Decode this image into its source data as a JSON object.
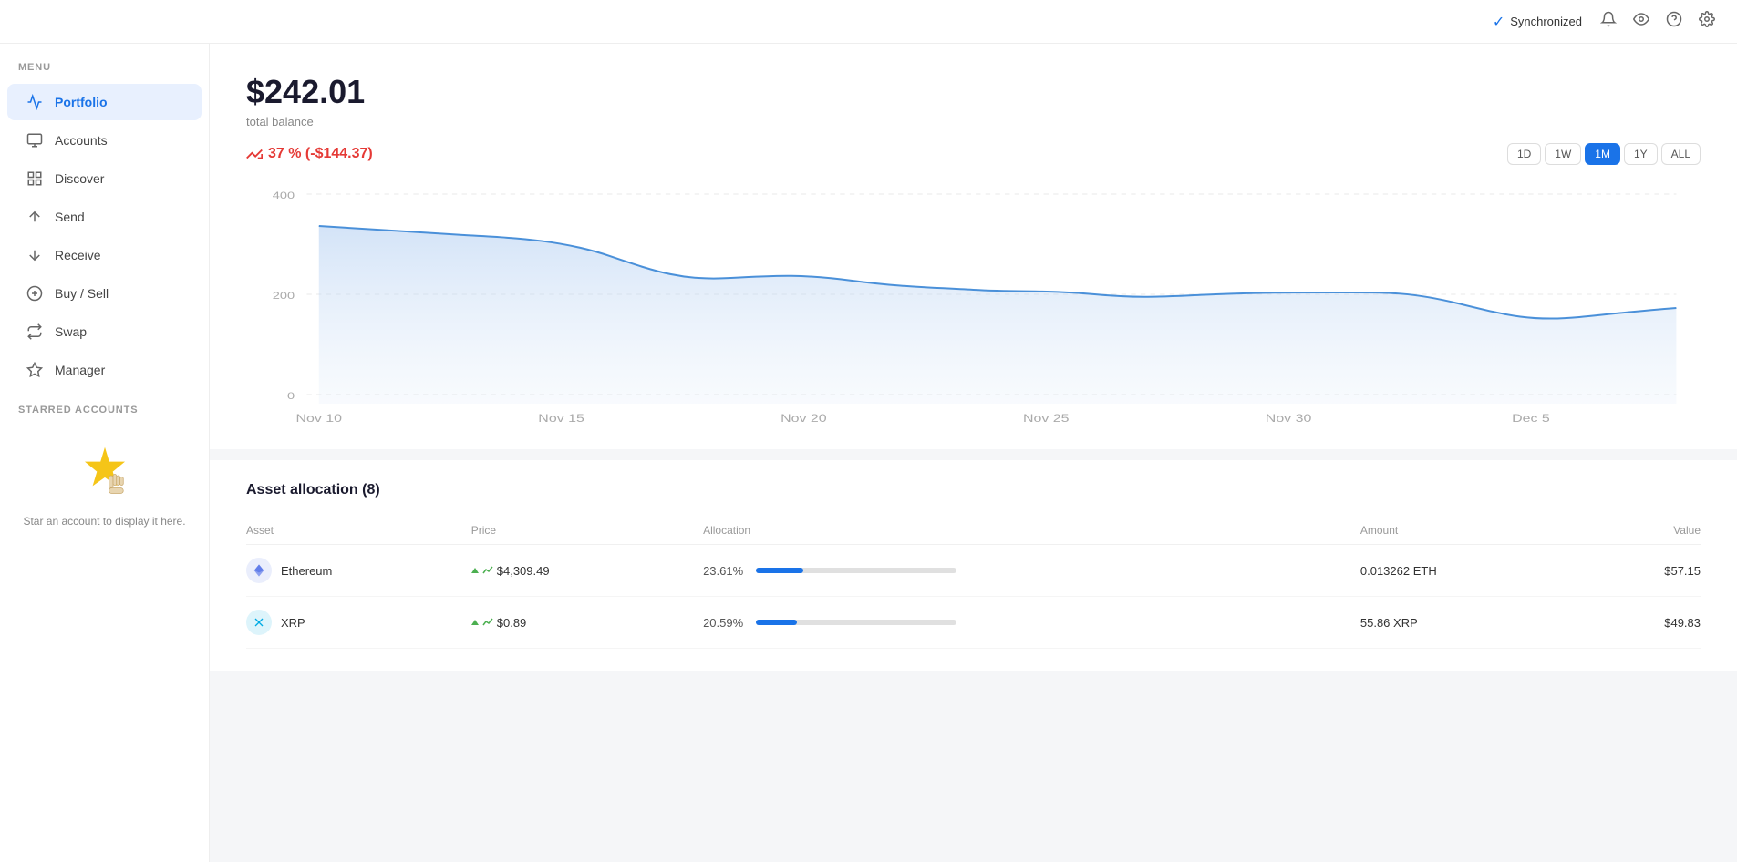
{
  "topbar": {
    "sync_label": "Synchronized",
    "bell_icon": "🔔",
    "eye_icon": "👁",
    "help_icon": "?",
    "settings_icon": "⚙"
  },
  "sidebar": {
    "menu_label": "MENU",
    "items": [
      {
        "id": "portfolio",
        "label": "Portfolio",
        "icon": "📈",
        "active": true
      },
      {
        "id": "accounts",
        "label": "Accounts",
        "icon": "🗂"
      },
      {
        "id": "discover",
        "label": "Discover",
        "icon": "⊞"
      },
      {
        "id": "send",
        "label": "Send",
        "icon": "↑"
      },
      {
        "id": "receive",
        "label": "Receive",
        "icon": "↓"
      },
      {
        "id": "buy-sell",
        "label": "Buy / Sell",
        "icon": "💲"
      },
      {
        "id": "swap",
        "label": "Swap",
        "icon": "⇄"
      },
      {
        "id": "manager",
        "label": "Manager",
        "icon": "✦"
      }
    ],
    "starred_label": "STARRED ACCOUNTS",
    "starred_empty_text": "Star an account to display it here.",
    "star_icon": "⭐"
  },
  "portfolio": {
    "total_balance": "$242.01",
    "total_balance_label": "total balance",
    "change": "37 % (-$144.37)",
    "time_filters": [
      {
        "id": "1d",
        "label": "1D",
        "active": false
      },
      {
        "id": "1w",
        "label": "1W",
        "active": false
      },
      {
        "id": "1m",
        "label": "1M",
        "active": true
      },
      {
        "id": "1y",
        "label": "1Y",
        "active": false
      },
      {
        "id": "all",
        "label": "ALL",
        "active": false
      }
    ],
    "chart": {
      "y_labels": [
        "400",
        "200",
        "0"
      ],
      "x_labels": [
        "Nov 10",
        "Nov 15",
        "Nov 20",
        "Nov 25",
        "Nov 30",
        "Dec 5"
      ],
      "color": "#4a90d9"
    }
  },
  "asset_allocation": {
    "title": "Asset allocation",
    "count": 8,
    "columns": [
      "Asset",
      "Price",
      "Allocation",
      "Amount",
      "Value"
    ],
    "rows": [
      {
        "name": "Ethereum",
        "icon_type": "eth",
        "icon_char": "◆",
        "price": "$4,309.49",
        "price_trend": "up",
        "allocation_pct": "23.61%",
        "allocation_bar": 23.61,
        "amount": "0.013262 ETH",
        "value": "$57.15"
      },
      {
        "name": "XRP",
        "icon_type": "xrp",
        "icon_char": "✕",
        "price": "$0.89",
        "price_trend": "up",
        "allocation_pct": "20.59%",
        "allocation_bar": 20.59,
        "amount": "55.86 XRP",
        "value": "$49.83"
      }
    ]
  }
}
